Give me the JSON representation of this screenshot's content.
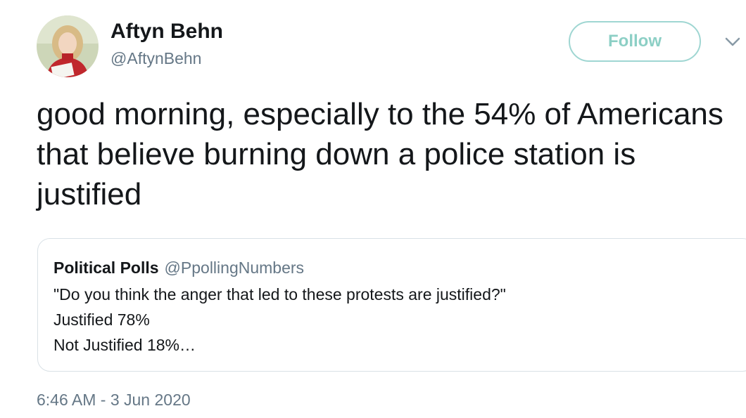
{
  "tweet": {
    "author": {
      "name": "Aftyn Behn",
      "handle": "@AftynBehn",
      "avatar_icon": "profile-photo"
    },
    "follow_label": "Follow",
    "menu_icon": "chevron-down-icon",
    "text": "good morning, especially to the 54% of Americans that believe burning down a police station is justified",
    "quoted": {
      "name": "Political Polls",
      "handle": "@PpollingNumbers",
      "lines": [
        "\"Do you think the anger that led to these protests are justified?\"",
        "Justified 78%",
        "Not Justified 18%…"
      ]
    },
    "timestamp": "6:46 AM - 3 Jun 2020"
  },
  "colors": {
    "text": "#14171a",
    "secondary": "#657786",
    "follow_border": "#9fd6d2",
    "follow_text": "#8ccfc5",
    "quote_border": "#d9e1e6"
  }
}
